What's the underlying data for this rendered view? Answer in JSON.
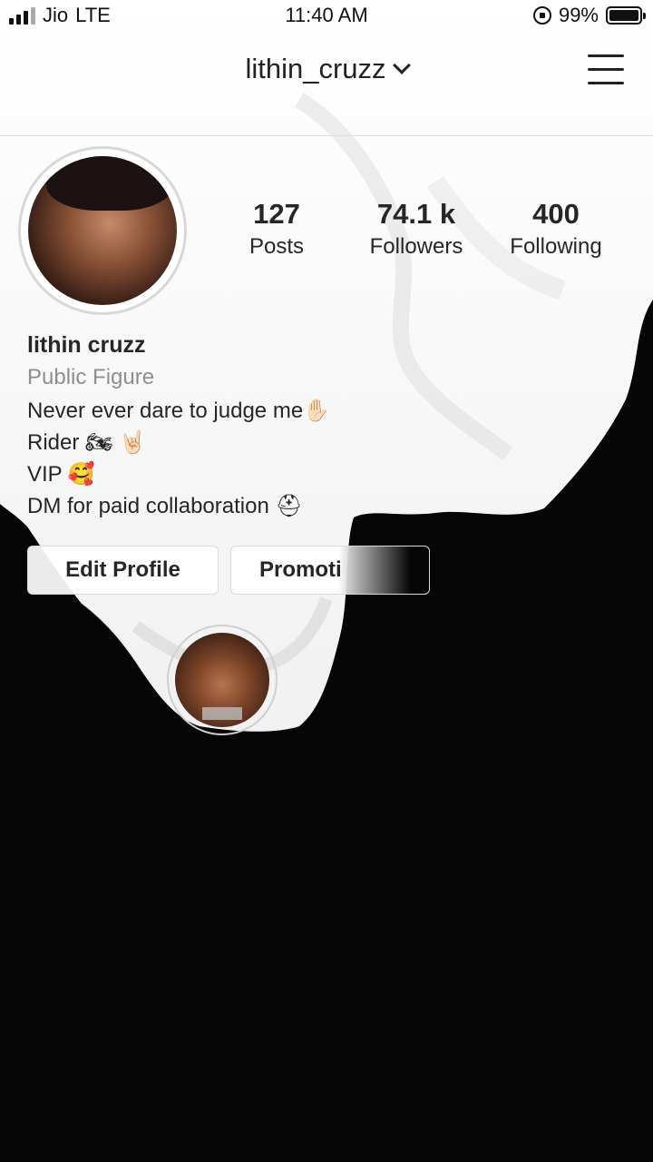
{
  "status_bar": {
    "carrier": "Jio",
    "network": "LTE",
    "time": "11:40 AM",
    "battery": "99%",
    "battery_level": 0.99
  },
  "header": {
    "username": "lithin_cruzz",
    "dropdown_icon": "chevron-down-icon",
    "menu_icon": "hamburger-menu-icon"
  },
  "profile": {
    "stats": [
      {
        "value": "127",
        "label": "Posts"
      },
      {
        "value": "74.1 k",
        "label": "Followers"
      },
      {
        "value": "400",
        "label": "Following"
      }
    ],
    "name": "lithin cruzz",
    "category": "Public Figure",
    "bio_lines": [
      "Never ever dare to judge me✋🏻",
      "Rider 🏍 🤘🏻",
      "VIP 🥰",
      "DM for paid collaboration ⛑"
    ]
  },
  "actions": {
    "edit_profile": "Edit Profile",
    "promotions": "Promoti"
  },
  "colors": {
    "text": "#262626",
    "muted": "#8e8e8e",
    "border": "#dbdbdb",
    "background_dark": "#050505"
  }
}
